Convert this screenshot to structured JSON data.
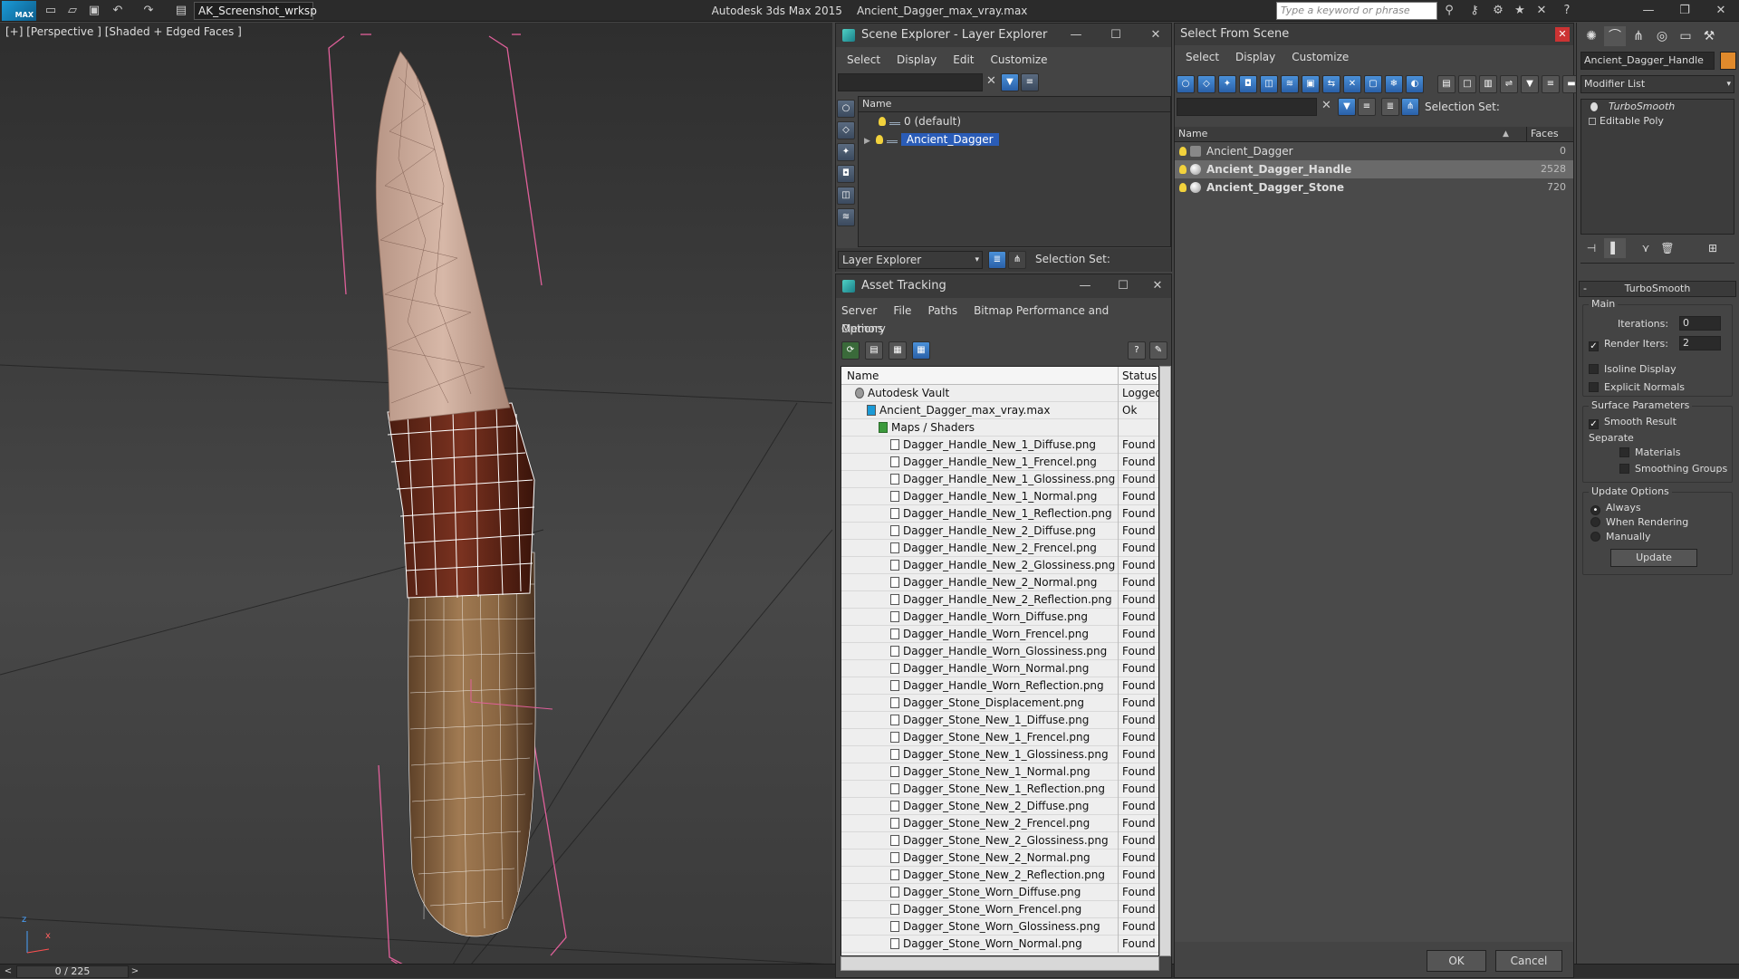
{
  "app": {
    "title": "Autodesk 3ds Max  2015",
    "file": "Ancient_Dagger_max_vray.max",
    "workspace": "AK_Screenshot_wrksp",
    "search_placeholder": "Type a keyword or phrase"
  },
  "viewport": {
    "label": "[+] [Perspective ] [Shaded + Edged Faces ]",
    "axis_z": "z",
    "axis_x": "x"
  },
  "timeline": {
    "frame": "0 / 225"
  },
  "scene_explorer": {
    "title": "Scene Explorer - Layer Explorer",
    "menu": [
      "Select",
      "Display",
      "Edit",
      "Customize"
    ],
    "col_name": "Name",
    "rows": [
      {
        "name": "0 (default)",
        "selected": false
      },
      {
        "name": "Ancient_Dagger",
        "selected": true
      }
    ],
    "footer_combo": "Layer Explorer",
    "selection_set_label": "Selection Set:"
  },
  "asset_tracking": {
    "title": "Asset Tracking",
    "menu": [
      "Server",
      "File",
      "Paths",
      "Bitmap Performance and Memory"
    ],
    "menu2": "Options",
    "col_name": "Name",
    "col_status": "Status",
    "rows": [
      {
        "name": "Autodesk Vault",
        "status": "Logged",
        "indent": 1,
        "kind": "vault"
      },
      {
        "name": "Ancient_Dagger_max_vray.max",
        "status": "Ok",
        "indent": 2,
        "kind": "max"
      },
      {
        "name": "Maps / Shaders",
        "status": "",
        "indent": 3,
        "kind": "folder"
      },
      {
        "name": "Dagger_Handle_New_1_Diffuse.png",
        "status": "Found",
        "indent": 4,
        "kind": "file"
      },
      {
        "name": "Dagger_Handle_New_1_Frencel.png",
        "status": "Found",
        "indent": 4,
        "kind": "file"
      },
      {
        "name": "Dagger_Handle_New_1_Glossiness.png",
        "status": "Found",
        "indent": 4,
        "kind": "file"
      },
      {
        "name": "Dagger_Handle_New_1_Normal.png",
        "status": "Found",
        "indent": 4,
        "kind": "file"
      },
      {
        "name": "Dagger_Handle_New_1_Reflection.png",
        "status": "Found",
        "indent": 4,
        "kind": "file"
      },
      {
        "name": "Dagger_Handle_New_2_Diffuse.png",
        "status": "Found",
        "indent": 4,
        "kind": "file"
      },
      {
        "name": "Dagger_Handle_New_2_Frencel.png",
        "status": "Found",
        "indent": 4,
        "kind": "file"
      },
      {
        "name": "Dagger_Handle_New_2_Glossiness.png",
        "status": "Found",
        "indent": 4,
        "kind": "file"
      },
      {
        "name": "Dagger_Handle_New_2_Normal.png",
        "status": "Found",
        "indent": 4,
        "kind": "file"
      },
      {
        "name": "Dagger_Handle_New_2_Reflection.png",
        "status": "Found",
        "indent": 4,
        "kind": "file"
      },
      {
        "name": "Dagger_Handle_Worn_Diffuse.png",
        "status": "Found",
        "indent": 4,
        "kind": "file"
      },
      {
        "name": "Dagger_Handle_Worn_Frencel.png",
        "status": "Found",
        "indent": 4,
        "kind": "file"
      },
      {
        "name": "Dagger_Handle_Worn_Glossiness.png",
        "status": "Found",
        "indent": 4,
        "kind": "file"
      },
      {
        "name": "Dagger_Handle_Worn_Normal.png",
        "status": "Found",
        "indent": 4,
        "kind": "file"
      },
      {
        "name": "Dagger_Handle_Worn_Reflection.png",
        "status": "Found",
        "indent": 4,
        "kind": "file"
      },
      {
        "name": "Dagger_Stone_Displacement.png",
        "status": "Found",
        "indent": 4,
        "kind": "file"
      },
      {
        "name": "Dagger_Stone_New_1_Diffuse.png",
        "status": "Found",
        "indent": 4,
        "kind": "file"
      },
      {
        "name": "Dagger_Stone_New_1_Frencel.png",
        "status": "Found",
        "indent": 4,
        "kind": "file"
      },
      {
        "name": "Dagger_Stone_New_1_Glossiness.png",
        "status": "Found",
        "indent": 4,
        "kind": "file"
      },
      {
        "name": "Dagger_Stone_New_1_Normal.png",
        "status": "Found",
        "indent": 4,
        "kind": "file"
      },
      {
        "name": "Dagger_Stone_New_1_Reflection.png",
        "status": "Found",
        "indent": 4,
        "kind": "file"
      },
      {
        "name": "Dagger_Stone_New_2_Diffuse.png",
        "status": "Found",
        "indent": 4,
        "kind": "file"
      },
      {
        "name": "Dagger_Stone_New_2_Frencel.png",
        "status": "Found",
        "indent": 4,
        "kind": "file"
      },
      {
        "name": "Dagger_Stone_New_2_Glossiness.png",
        "status": "Found",
        "indent": 4,
        "kind": "file"
      },
      {
        "name": "Dagger_Stone_New_2_Normal.png",
        "status": "Found",
        "indent": 4,
        "kind": "file"
      },
      {
        "name": "Dagger_Stone_New_2_Reflection.png",
        "status": "Found",
        "indent": 4,
        "kind": "file"
      },
      {
        "name": "Dagger_Stone_Worn_Diffuse.png",
        "status": "Found",
        "indent": 4,
        "kind": "file"
      },
      {
        "name": "Dagger_Stone_Worn_Frencel.png",
        "status": "Found",
        "indent": 4,
        "kind": "file"
      },
      {
        "name": "Dagger_Stone_Worn_Glossiness.png",
        "status": "Found",
        "indent": 4,
        "kind": "file"
      },
      {
        "name": "Dagger_Stone_Worn_Normal.png",
        "status": "Found",
        "indent": 4,
        "kind": "file"
      }
    ]
  },
  "select_from_scene": {
    "title": "Select From Scene",
    "menu": [
      "Select",
      "Display",
      "Customize"
    ],
    "selection_set_label": "Selection Set:",
    "col_name": "Name",
    "col_faces": "Faces",
    "rows": [
      {
        "name": "Ancient_Dagger",
        "faces": "0",
        "selected": false,
        "bold": false
      },
      {
        "name": "Ancient_Dagger_Handle",
        "faces": "2528",
        "selected": true,
        "bold": true
      },
      {
        "name": "Ancient_Dagger_Stone",
        "faces": "720",
        "selected": false,
        "bold": true
      }
    ],
    "ok_label": "OK",
    "cancel_label": "Cancel"
  },
  "command_panel": {
    "object_name": "Ancient_Dagger_Handle",
    "modifier_list": "Modifier List",
    "stack": [
      "TurboSmooth",
      "Editable Poly"
    ],
    "rollout_title": "TurboSmooth",
    "main_label": "Main",
    "iterations_label": "Iterations:",
    "iterations_value": "0",
    "render_iters_label": "Render Iters:",
    "render_iters_value": "2",
    "render_iters_checked": true,
    "isoline_label": "Isoline Display",
    "explicit_normals_label": "Explicit Normals",
    "surface_params_label": "Surface Parameters",
    "smooth_result_label": "Smooth Result",
    "separate_label": "Separate",
    "materials_label": "Materials",
    "smoothing_groups_label": "Smoothing Groups",
    "update_options_label": "Update Options",
    "always_label": "Always",
    "when_rendering_label": "When Rendering",
    "manually_label": "Manually",
    "update_button": "Update"
  },
  "colors": {
    "selection_blue": "#2a5cb7",
    "wire_pink": "#e0609a",
    "blade": "#c8a89a",
    "wrap": "#6b2a1a",
    "horn": "#8a6a48"
  }
}
